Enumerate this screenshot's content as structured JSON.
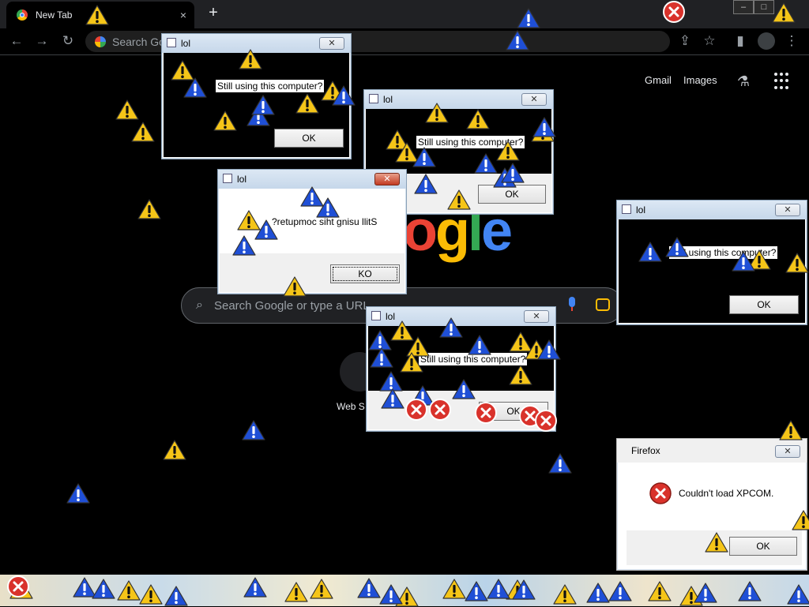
{
  "browser": {
    "tab_title": "New Tab",
    "tab_close": "×",
    "new_tab": "+",
    "back": "←",
    "forward": "→",
    "reload": "↻",
    "omnibox_placeholder": "Search Go",
    "menu": "⋮"
  },
  "google": {
    "gmail": "Gmail",
    "images": "Images",
    "logo_text": "ogle",
    "search_placeholder": "Search Google or type a URL",
    "shortcut_label": "Web S"
  },
  "dialogs": {
    "lol1": {
      "title": "lol",
      "message": "Still using this computer?",
      "ok": "OK",
      "close": "✕"
    },
    "lol2": {
      "title": "lol",
      "message": "Still using this computer?",
      "ok": "OK",
      "close": "✕"
    },
    "lol3": {
      "title": "lol",
      "message": "?retupmoc siht gnisu llitS",
      "ok": "KO",
      "close": "✕"
    },
    "lol4": {
      "title": "lol",
      "message": "Still using this computer?",
      "ok": "OK",
      "close": "✕"
    },
    "lol5": {
      "title": "lol",
      "message": "Still using this computer?",
      "ok": "OK",
      "close": "✕"
    },
    "firefox": {
      "title": "Firefox",
      "message": "Couldn't load XPCOM.",
      "ok": "OK",
      "close": "✕"
    }
  },
  "icons": {
    "warning": "warning-icon",
    "info": "info-icon",
    "error": "error-icon"
  },
  "colors": {
    "warning_yellow": "#f5c518",
    "info_blue": "#1f4fd6",
    "error_red": "#d9322b",
    "google_blue": "#4285f4",
    "google_red": "#ea4335",
    "google_yellow": "#fbbc05",
    "google_green": "#34a853"
  }
}
